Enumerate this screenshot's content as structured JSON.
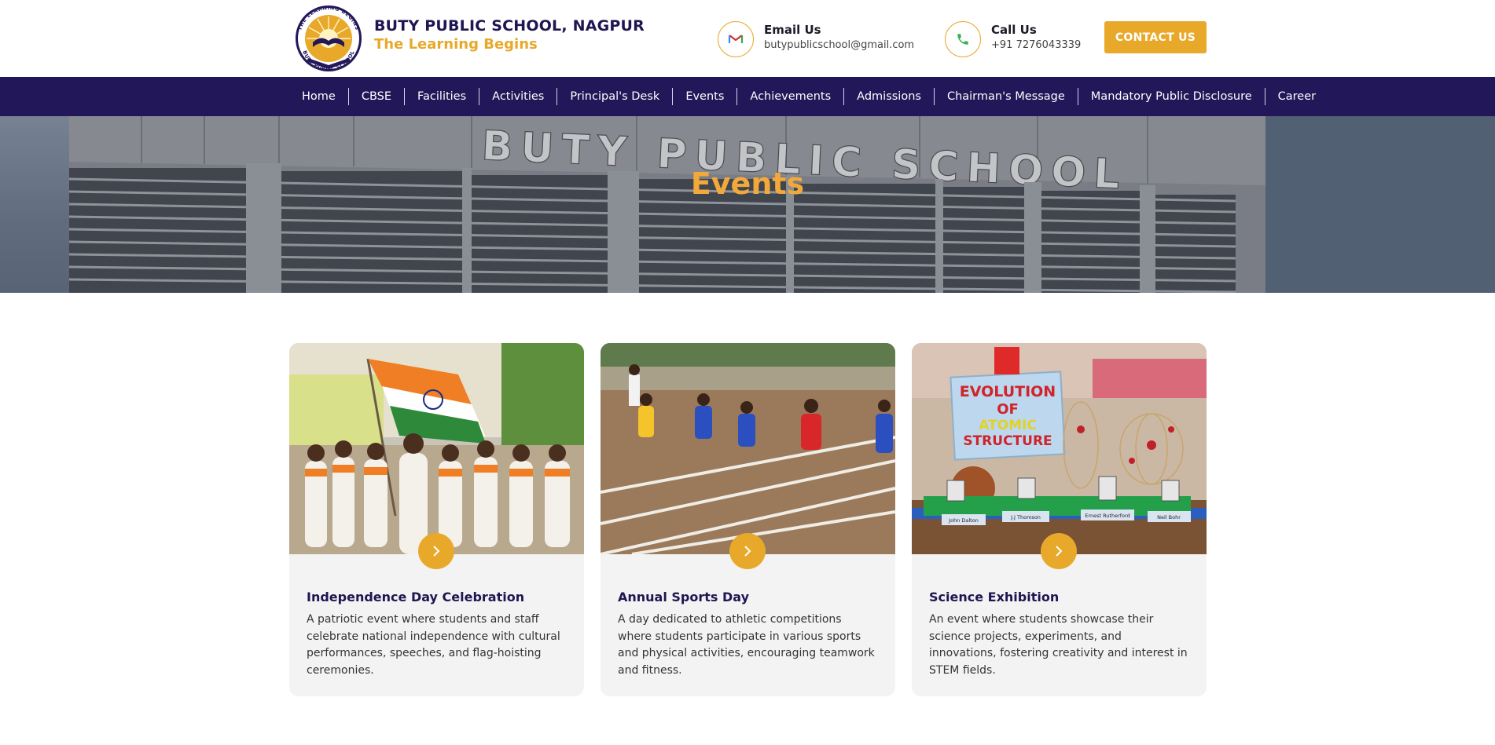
{
  "header": {
    "school_name": "BUTY PUBLIC SCHOOL, NAGPUR",
    "tagline": "The Learning Begins",
    "logo": {
      "ring_text_top": "THE LEARNING BEGINS",
      "ring_text_bottom": "BUTY PUBLIC SCHOOL",
      "icon": "logo-emblem"
    },
    "email": {
      "icon": "gmail-icon",
      "title": "Email Us",
      "value": "butypublicschool@gmail.com"
    },
    "phone": {
      "icon": "phone-icon",
      "title": "Call Us",
      "value": "+91 7276043339"
    },
    "contact_button": "CONTACT US"
  },
  "nav": {
    "items": [
      {
        "label": "Home"
      },
      {
        "label": "CBSE"
      },
      {
        "label": "Facilities"
      },
      {
        "label": "Activities"
      },
      {
        "label": "Principal's Desk"
      },
      {
        "label": "Events"
      },
      {
        "label": "Achievements"
      },
      {
        "label": "Admissions"
      },
      {
        "label": "Chairman's Message"
      },
      {
        "label": "Mandatory Public Disclosure"
      },
      {
        "label": "Career"
      }
    ]
  },
  "banner": {
    "title": "Events",
    "building_sign": "BUTY PUBLIC SCHOOL"
  },
  "events": [
    {
      "title": "Independence Day Celebration",
      "description": "A patriotic event where students and staff celebrate national independence with cultural performances, speeches, and flag-hoisting ceremonies.",
      "image": "independence-day-photo"
    },
    {
      "title": "Annual Sports Day",
      "description": "A day dedicated to athletic competitions where students participate in various sports and physical activities, encouraging teamwork and fitness.",
      "image": "sports-day-photo"
    },
    {
      "title": "Science Exhibition",
      "description": "An event where students showcase their science projects, experiments, and innovations, fostering creativity and interest in STEM fields.",
      "image": "science-exhibition-photo",
      "model_sign": [
        "EVOLUTION",
        "OF",
        "ATOMIC",
        "STRUCTURE"
      ],
      "scientist_labels": [
        "John Dalton",
        "J.J Thomson",
        "Ernest Rutherford",
        "Neil Bohr"
      ]
    }
  ],
  "colors": {
    "brand_navy": "#221759",
    "accent_gold": "#e8a92b",
    "card_bg": "#f3f3f3"
  }
}
